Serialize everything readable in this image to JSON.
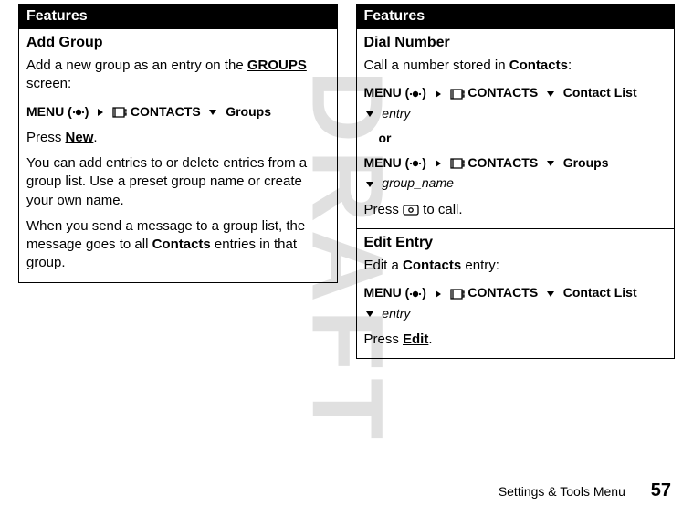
{
  "watermark": "DRAFT",
  "left": {
    "header": "Features",
    "addGroup": {
      "title": "Add Group",
      "intro_prefix": "Add a new group as an entry on the ",
      "intro_underline": "GROUPS",
      "intro_suffix": " screen:",
      "menu_label": "MENU",
      "menu_paren_open": "(",
      "menu_paren_close": ")",
      "contacts_label": "CONTACTS",
      "groups_label": "Groups",
      "press_prefix": "Press ",
      "press_underline": "New",
      "press_suffix": ".",
      "body1": "You can add entries to or delete entries from a group list. Use a preset group name or create your own name.",
      "body2_prefix": "When you send a message to a group list, the message goes to all ",
      "body2_bold": "Contacts",
      "body2_suffix": " entries in that group."
    }
  },
  "right": {
    "header": "Features",
    "dialNumber": {
      "title": "Dial Number",
      "intro_prefix": "Call a number stored in ",
      "intro_bold": "Contacts",
      "intro_suffix": ":",
      "menu_label": "MENU",
      "contacts_label": "CONTACTS",
      "contact_list_label": "Contact List",
      "entry_label": "entry",
      "or_label": "or",
      "groups_label": "Groups",
      "group_name_label": "group_name",
      "press_prefix": "Press ",
      "press_suffix": " to call."
    },
    "editEntry": {
      "title": "Edit Entry",
      "intro_prefix": "Edit a ",
      "intro_bold": "Contacts",
      "intro_suffix": " entry:",
      "menu_label": "MENU",
      "contacts_label": "CONTACTS",
      "contact_list_label": "Contact List",
      "entry_label": "entry",
      "press_prefix": "Press ",
      "press_underline": "Edit",
      "press_suffix": "."
    }
  },
  "footer": {
    "section": "Settings & Tools Menu",
    "page": "57"
  }
}
